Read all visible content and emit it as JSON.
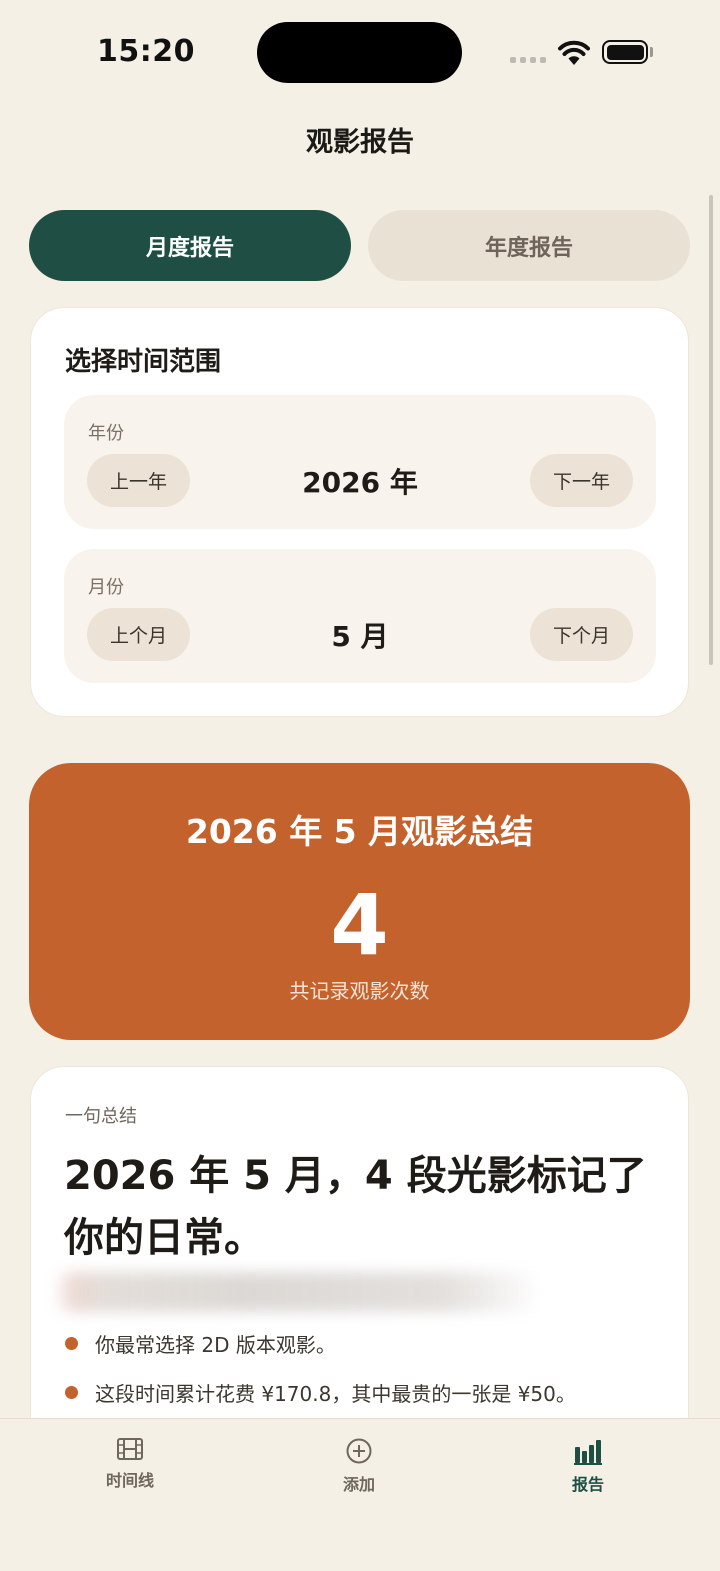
{
  "status_bar": {
    "time": "15:20"
  },
  "nav": {
    "title": "观影报告"
  },
  "tabs": [
    {
      "label": "月度报告",
      "active": true
    },
    {
      "label": "年度报告",
      "active": false
    }
  ],
  "range": {
    "title": "选择时间范围",
    "year": {
      "label": "年份",
      "prev": "上一年",
      "value": "2026 年",
      "next": "下一年"
    },
    "month": {
      "label": "月份",
      "prev": "上个月",
      "value": "5 月",
      "next": "下个月"
    }
  },
  "summary": {
    "title": "2026 年 5 月观影总结",
    "count": "4",
    "caption": "共记录观影次数",
    "color": "#c4622e"
  },
  "one_line": {
    "label": "一句总结",
    "headline": "2026 年 5 月，4 段光影标记了你的日常。",
    "bullets": [
      "你最常选择 2D 版本观影。",
      "这段时间累计花费 ¥170.8，其中最贵的一张是 ¥50。"
    ]
  },
  "tabbar": {
    "items": [
      {
        "label": "时间线",
        "icon": "film-icon"
      },
      {
        "label": "添加",
        "icon": "plus-circle-icon"
      },
      {
        "label": "报告",
        "icon": "bar-chart-icon",
        "current": true
      }
    ]
  },
  "colors": {
    "accent_green": "#1f4f44",
    "accent_orange": "#c4622e",
    "background": "#f4f0e6"
  }
}
